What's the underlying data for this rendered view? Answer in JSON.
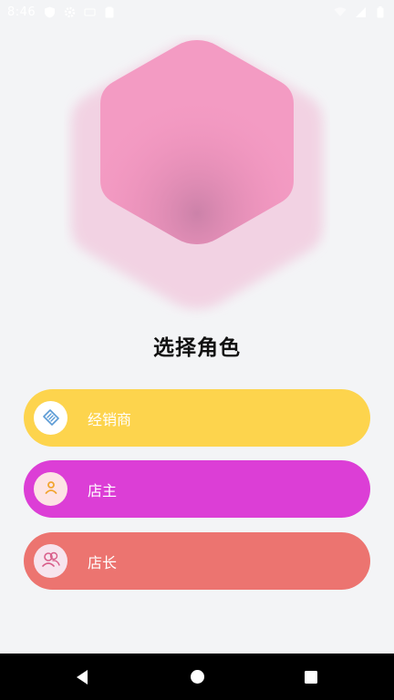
{
  "status_bar": {
    "time": "8:46",
    "left_icons": [
      "shield-icon",
      "gear-icon",
      "notification-icon",
      "clipboard-icon"
    ],
    "right_icons": [
      "wifi-icon",
      "signal-icon",
      "battery-icon"
    ]
  },
  "title": "选择角色",
  "roles": [
    {
      "label": "经销商",
      "icon": "handshake-icon",
      "color": "#fdd44d",
      "icon_color": "#5b9bd5"
    },
    {
      "label": "店主",
      "icon": "person-icon",
      "color": "#dc3ed6",
      "icon_color": "#f2a531"
    },
    {
      "label": "店长",
      "icon": "people-icon",
      "color": "#ec7470",
      "icon_color": "#d85d8a"
    }
  ],
  "hero": {
    "icon": "hexagon-icon",
    "front_color": "#f393bd",
    "back_color": "#f3cfe0"
  },
  "nav": {
    "icons": [
      "back-icon",
      "home-icon",
      "recents-icon"
    ]
  }
}
